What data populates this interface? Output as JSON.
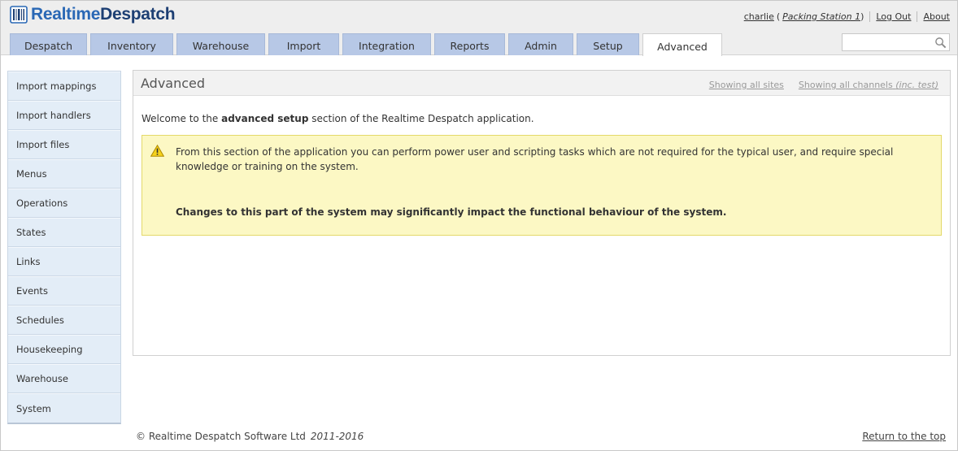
{
  "brand": {
    "name_part1": "Realtime",
    "name_part2": "Despatch",
    "color_primary": "#2a68b5",
    "color_dark": "#1d3f73"
  },
  "user": {
    "name": "charlie",
    "station_open": "(",
    "station": "Packing Station 1",
    "station_close": ")",
    "logout_label": "Log Out",
    "about_label": "About"
  },
  "tabs": [
    {
      "label": "Despatch",
      "active": false
    },
    {
      "label": "Inventory",
      "active": false
    },
    {
      "label": "Warehouse",
      "active": false
    },
    {
      "label": "Import",
      "active": false
    },
    {
      "label": "Integration",
      "active": false
    },
    {
      "label": "Reports",
      "active": false
    },
    {
      "label": "Admin",
      "active": false
    },
    {
      "label": "Setup",
      "active": false
    },
    {
      "label": "Advanced",
      "active": true
    }
  ],
  "search": {
    "value": "",
    "icon": "search-icon"
  },
  "sidebar": {
    "items": [
      {
        "label": "Import mappings"
      },
      {
        "label": "Import handlers"
      },
      {
        "label": "Import files"
      },
      {
        "label": "Menus"
      },
      {
        "label": "Operations"
      },
      {
        "label": "States"
      },
      {
        "label": "Links"
      },
      {
        "label": "Events"
      },
      {
        "label": "Schedules"
      },
      {
        "label": "Housekeeping"
      },
      {
        "label": "Warehouse"
      },
      {
        "label": "System"
      }
    ]
  },
  "panel": {
    "title": "Advanced",
    "sites_link": "Showing all sites",
    "channels_link": "Showing all channels",
    "channels_link_suffix": "(inc. test)",
    "welcome_prefix": "Welcome to the",
    "welcome_bold": "advanced setup",
    "welcome_suffix": "section of the Realtime Despatch application.",
    "notice_text": "From this section of the application you can perform power user and scripting tasks which are not required for the typical user, and require special knowledge or training on the system.",
    "notice_bold": "Changes to this part of the system may significantly impact the functional behaviour of the system.",
    "notice_icon": "warning-icon",
    "notice_bg": "#fcf8c4",
    "notice_border": "#e4d96a"
  },
  "footer": {
    "copyright": "© Realtime Despatch Software Ltd",
    "years": "2011-2016",
    "top_link": "Return to the top"
  },
  "colors": {
    "tab_bg": "#b7c8e6",
    "sidebar_bg": "#e3edf7",
    "header_bg": "#eeeeee"
  }
}
